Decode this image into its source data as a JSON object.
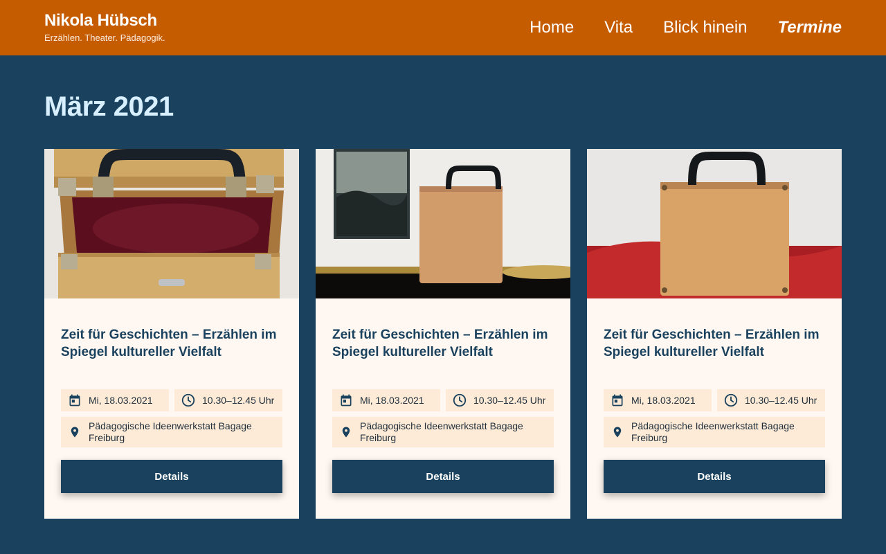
{
  "header": {
    "brand_name": "Nikola Hübsch",
    "brand_tagline": "Erzählen. Theater. Pädagogik.",
    "nav": [
      {
        "label": "Home"
      },
      {
        "label": "Vita"
      },
      {
        "label": "Blick hinein"
      },
      {
        "label": "Termine",
        "active": true
      }
    ]
  },
  "page": {
    "month_heading": "März 2021"
  },
  "cards": [
    {
      "image_icon": "open-wooden-case-photo",
      "title": "Zeit für Geschichten – Erzählen im Spiegel kultureller Vielfalt",
      "date": "Mi, 18.03.2021",
      "time": "10.30–12.45 Uhr",
      "location": "Pädagogische Ideenwerkstatt Bagage Freiburg",
      "button": "Details"
    },
    {
      "image_icon": "wooden-case-with-painting-photo",
      "title": "Zeit für Geschichten – Erzählen im Spiegel kultureller Vielfalt",
      "date": "Mi, 18.03.2021",
      "time": "10.30–12.45 Uhr",
      "location": "Pädagogische Ideenwerkstatt Bagage Freiburg",
      "button": "Details"
    },
    {
      "image_icon": "wooden-case-on-red-cloth-photo",
      "title": "Zeit für Geschichten – Erzählen im Spiegel kultureller Vielfalt",
      "date": "Mi, 18.03.2021",
      "time": "10.30–12.45 Uhr",
      "location": "Pädagogische Ideenwerkstatt Bagage Freiburg",
      "button": "Details"
    }
  ],
  "colors": {
    "header_bg": "#c65c00",
    "page_bg": "#1a425e",
    "card_bg": "#fff8f2",
    "chip_bg": "#fdebd7",
    "heading_accent": "#d7efff"
  }
}
